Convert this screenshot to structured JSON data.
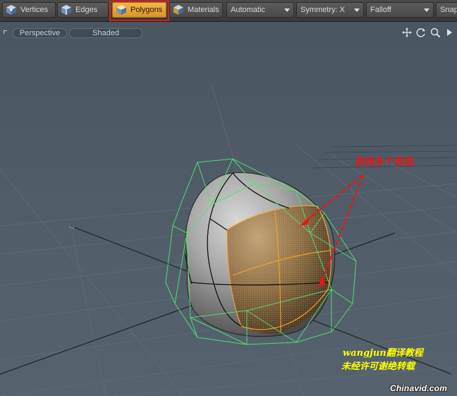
{
  "toolbar": {
    "modes": [
      {
        "label": "Vertices",
        "icon": "vertices-cube-icon",
        "active": false
      },
      {
        "label": "Edges",
        "icon": "edges-cube-icon",
        "active": false
      },
      {
        "label": "Polygons",
        "icon": "polygons-cube-icon",
        "active": true
      },
      {
        "label": "Materials",
        "icon": "materials-cube-icon",
        "active": false
      }
    ],
    "action_center": "Automatic",
    "symmetry": "Symmetry: X",
    "falloff": "Falloff",
    "snap": "Snap"
  },
  "viewport": {
    "projection": "Perspective",
    "shading": "Shaded",
    "icons": [
      "move-view-icon",
      "rotate-view-icon",
      "zoom-view-icon",
      "more-arrow-icon"
    ]
  },
  "annotations": {
    "callout": "选择多个表面",
    "credit_line1": "wangjun翻译教程",
    "credit_line2": "未经许可谢绝转载",
    "watermark": "Chinavid.com"
  },
  "colors": {
    "active_mode": "#f0a830",
    "highlight_box": "#d42020",
    "selection": "#f0a030",
    "bounding_wire": "#55e070",
    "callout_text": "#e31818",
    "credit_text": "#ffff00"
  }
}
